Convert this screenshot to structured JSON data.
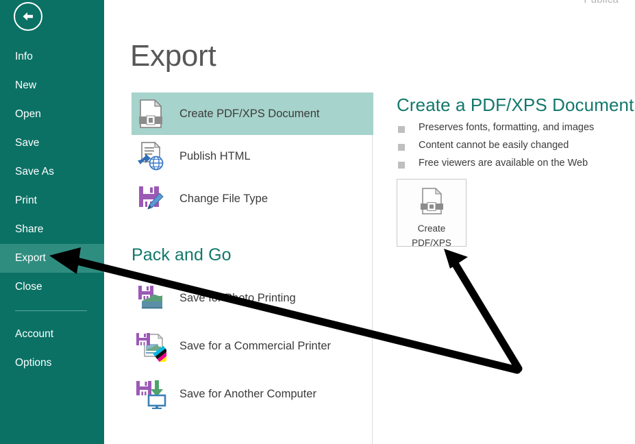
{
  "window": {
    "cut_off_title": "Publica"
  },
  "sidebar": {
    "back_button": "back-arrow",
    "items": [
      {
        "label": "Info",
        "active": false
      },
      {
        "label": "New",
        "active": false
      },
      {
        "label": "Open",
        "active": false
      },
      {
        "label": "Save",
        "active": false
      },
      {
        "label": "Save As",
        "active": false
      },
      {
        "label": "Print",
        "active": false
      },
      {
        "label": "Share",
        "active": false
      },
      {
        "label": "Export",
        "active": true
      },
      {
        "label": "Close",
        "active": false
      }
    ],
    "bottom_items": [
      {
        "label": "Account"
      },
      {
        "label": "Options"
      }
    ]
  },
  "main": {
    "title": "Export",
    "options": [
      {
        "label": "Create PDF/XPS Document",
        "icon": "pdf-document-icon",
        "selected": true
      },
      {
        "label": "Publish HTML",
        "icon": "publish-html-icon",
        "selected": false
      },
      {
        "label": "Change File Type",
        "icon": "change-file-type-icon",
        "selected": false
      }
    ],
    "section_heading": "Pack and Go",
    "pack_options": [
      {
        "label": "Save for Photo Printing",
        "icon": "photo-printing-icon"
      },
      {
        "label": "Save for a Commercial Printer",
        "icon": "commercial-printer-icon"
      },
      {
        "label": "Save for Another Computer",
        "icon": "another-computer-icon"
      }
    ]
  },
  "right_panel": {
    "title": "Create a PDF/XPS Document",
    "bullets": [
      "Preserves fonts, formatting, and images",
      "Content cannot be easily changed",
      "Free viewers are available on the Web"
    ],
    "button": {
      "line1": "Create",
      "line2": "PDF/XPS",
      "icon": "pdf-document-icon"
    }
  },
  "annotations": {
    "arrow_to_export": "black-arrow-pointing-left-to-export",
    "arrow_to_create_pdf": "black-arrow-pointing-up-to-create-pdf-button"
  },
  "colors": {
    "sidebar_bg": "#0b7165",
    "sidebar_active": "#2f8d80",
    "accent_teal": "#13786b",
    "selection_highlight": "#a6d3cb",
    "annotation": "#000000"
  }
}
